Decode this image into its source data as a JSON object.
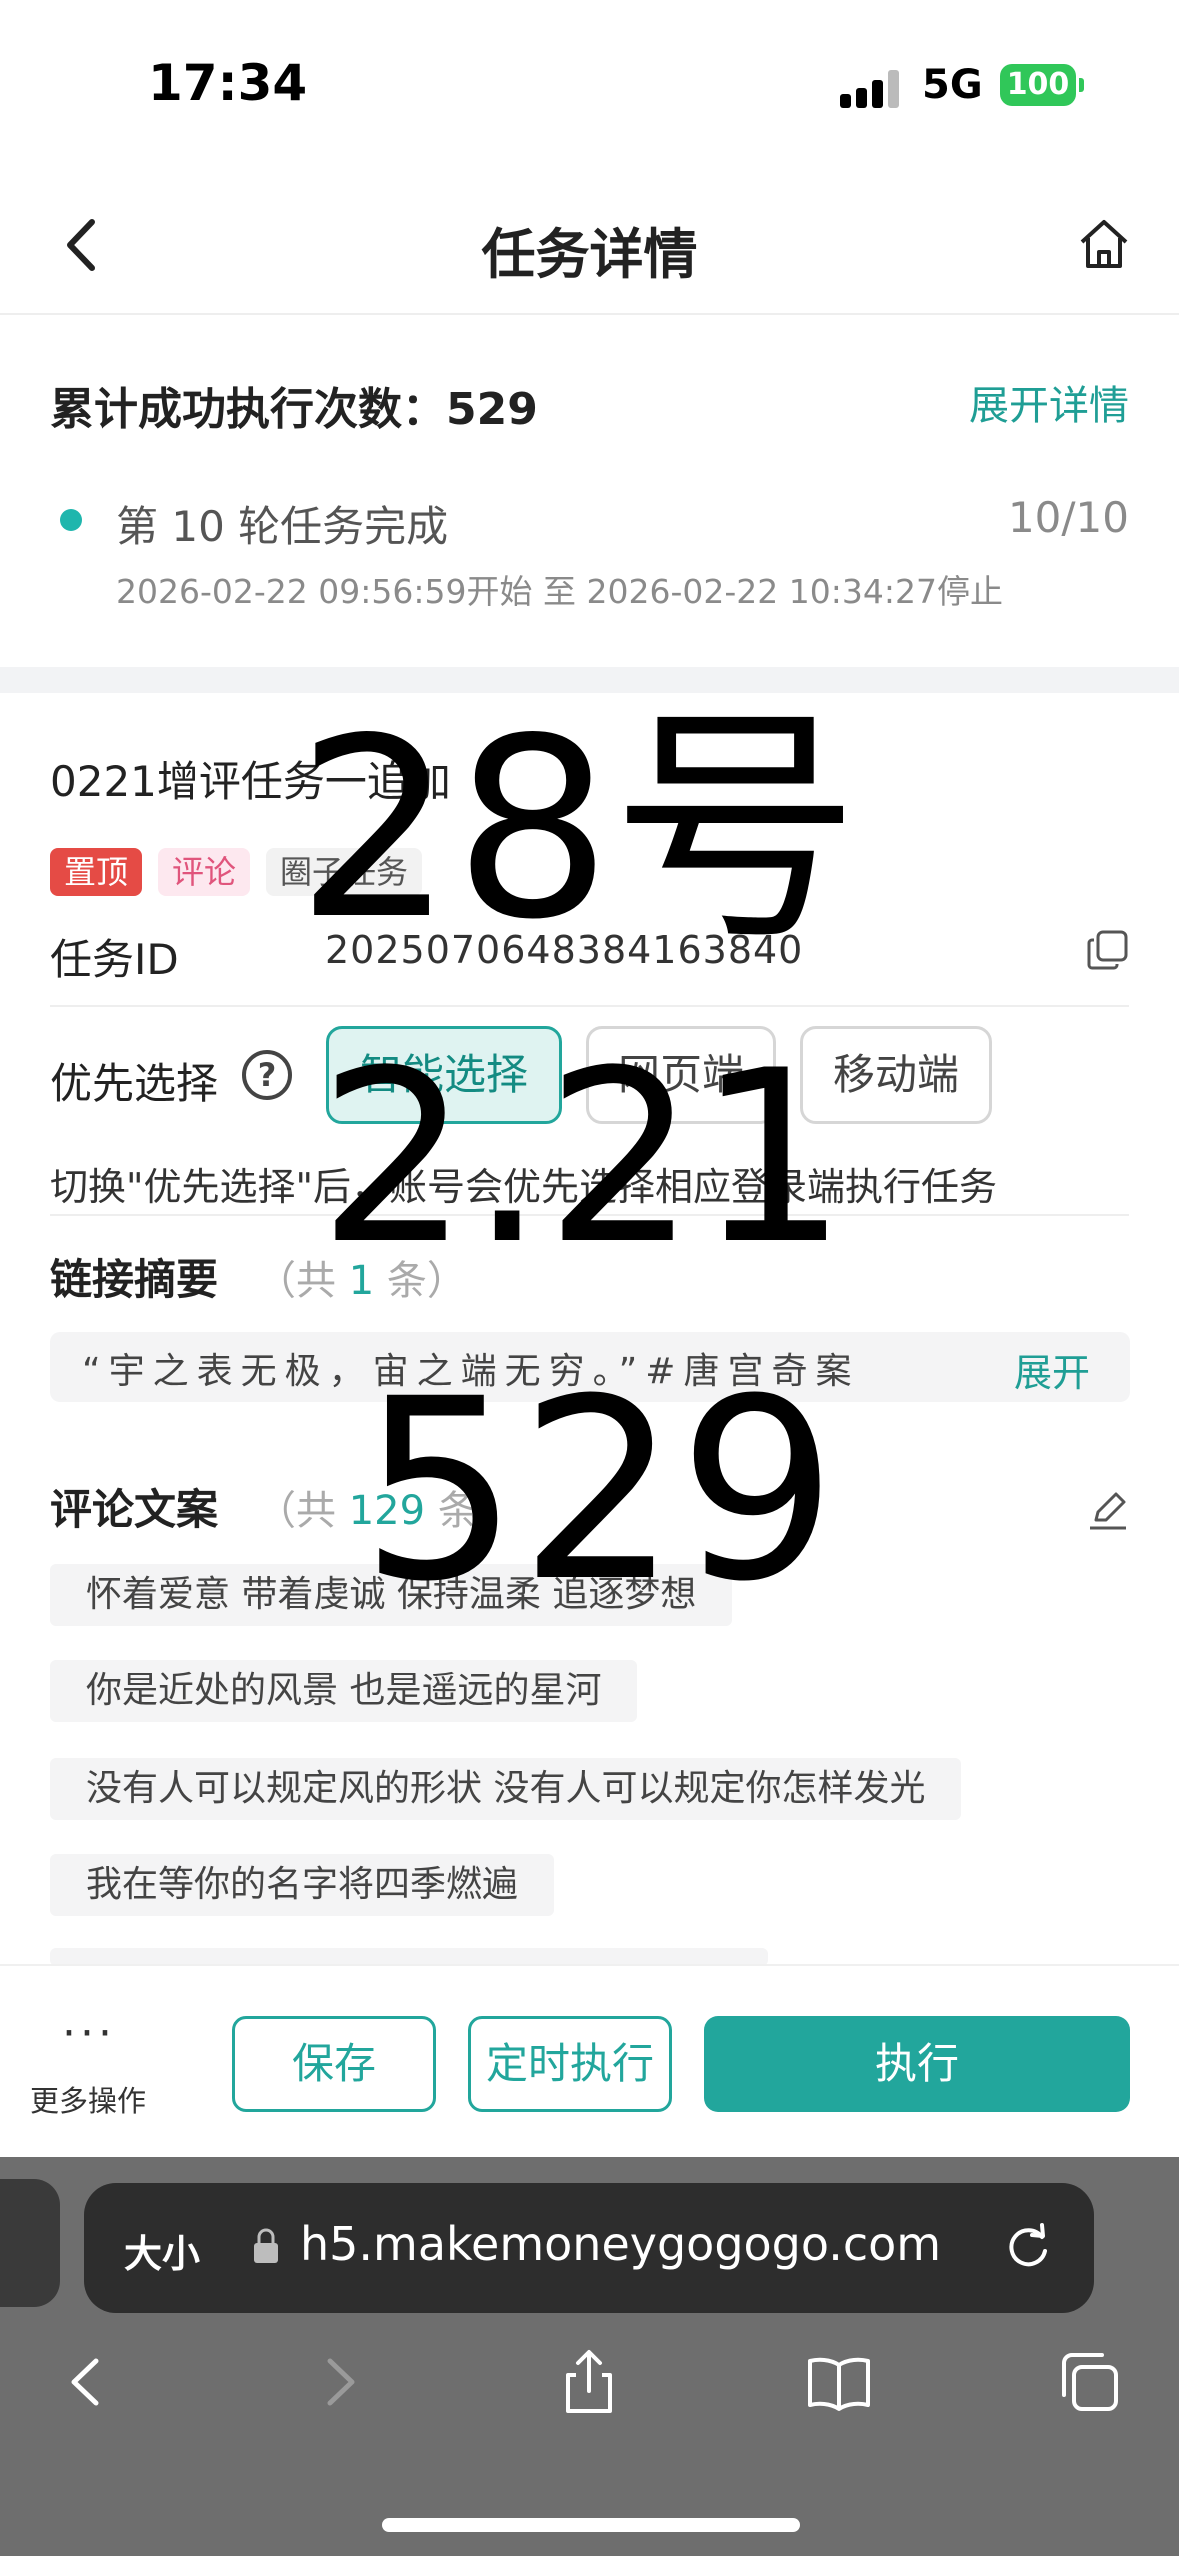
{
  "status_bar": {
    "time": "17:34",
    "network": "5G",
    "battery": "100"
  },
  "nav": {
    "title": "任务详情"
  },
  "summary": {
    "total_label": "累计成功执行次数：529",
    "expand_label": "展开详情",
    "round_text": "第 10 轮任务完成",
    "round_count": "10/10",
    "round_time": "2026-02-22 09:56:59开始 至 2026-02-22 10:34:27停止"
  },
  "task": {
    "name": "0221增评任务一追加",
    "tags": [
      "置顶",
      "评论",
      "圈子任务"
    ],
    "id_label": "任务ID",
    "id_value": "2025070648384163840",
    "priority_label": "优先选择",
    "priority_options": [
      "智能选择",
      "网页端",
      "移动端"
    ],
    "priority_selected": "智能选择",
    "priority_note": "切换\"优先选择\"后，账号会优先选择相应登录端执行任务"
  },
  "link_summary": {
    "label": "链接摘要",
    "count_prefix": "（共",
    "count": "1",
    "count_suffix": "条）",
    "text": "“宇之表无极，宙之端无穷。”#唐宫奇案",
    "expand_label": "展开"
  },
  "comments": {
    "label": "评论文案",
    "count_prefix": "（共",
    "count": "129",
    "count_suffix": "条）",
    "items": [
      "怀着爱意 带着虔诚 保持温柔 追逐梦想",
      "你是近处的风景 也是遥远的星河",
      "没有人可以规定风的形状 没有人可以规定你怎样发光",
      "我在等你的名字将四季燃遍"
    ]
  },
  "overlay": {
    "line1": "28号",
    "line2": "2.21",
    "line3": "529"
  },
  "actions": {
    "more_dots": "···",
    "more_label": "更多操作",
    "save_label": "保存",
    "schedule_label": "定时执行",
    "execute_label": "执行"
  },
  "browser": {
    "text_size_label": "大小",
    "url": "h5.makemoneygogogo.com"
  },
  "colors": {
    "accent": "#22a69c",
    "tag_top": "#e54b45",
    "tag_comment": "#e0557c"
  }
}
